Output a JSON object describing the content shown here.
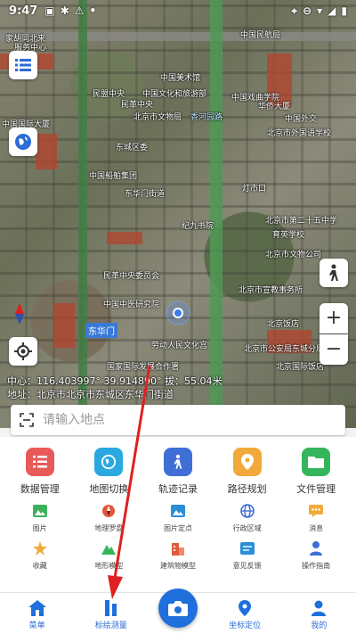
{
  "status_bar": {
    "time": "9:47"
  },
  "map": {
    "labels": [
      "家胡同北来",
      "服务中心",
      "中国民航局",
      "中国美术馆",
      "民盟中央",
      "中国文化和旅游部",
      "北京市文物局",
      "华侨大厦",
      "中国戏曲学院",
      "民革中央",
      "中国国际大厦",
      "中国外交",
      "香河园路",
      "北京市外国语学校",
      "东城区委",
      "中国船舶集团",
      "东华门街道",
      "灯市口",
      "纪九书院",
      "北京市第二十五中学",
      "育英学校",
      "北京市文物公司",
      "民革中央委员会",
      "北京市宣教事务所",
      "中国中医研究院",
      "东华门",
      "北京饭店",
      "北京市公安局东城分局",
      "北京国际饭店",
      "国家国际发展合作署",
      "劳动人民文化宫"
    ],
    "coord_line1": "中心：116.403997° 39.914890°  拔：55.04米",
    "coord_line2": "地址：北京市北京市东城区东华门街道"
  },
  "search": {
    "placeholder": "请输入地点"
  },
  "main_tools": [
    {
      "label": "数据管理",
      "icon": "list-icon",
      "color": "#e85a5a"
    },
    {
      "label": "地图切换",
      "icon": "globe-icon",
      "color": "#2aa8e0"
    },
    {
      "label": "轨迹记录",
      "icon": "walk-icon",
      "color": "#3f6fd6"
    },
    {
      "label": "路径规划",
      "icon": "location-pin-icon",
      "color": "#f2a93b"
    },
    {
      "label": "文件管理",
      "icon": "folder-icon",
      "color": "#35b55b"
    }
  ],
  "sub_tools_row1": [
    {
      "label": "图片",
      "icon": "image-icon",
      "color": "#3bb15b"
    },
    {
      "label": "地理罗盘",
      "icon": "compass-icon",
      "color": "#e05a3a"
    },
    {
      "label": "图片定点",
      "icon": "photo-pin-icon",
      "color": "#2a8fd6"
    },
    {
      "label": "行政区域",
      "icon": "globe-grid-icon",
      "color": "#3f6fd6"
    },
    {
      "label": "消息",
      "icon": "message-icon",
      "color": "#f2a93b"
    }
  ],
  "sub_tools_row2": [
    {
      "label": "收藏",
      "icon": "star-icon",
      "color": "#f2a93b"
    },
    {
      "label": "地形模型",
      "icon": "mountain-icon",
      "color": "#35b55b"
    },
    {
      "label": "建筑物模型",
      "icon": "building-icon",
      "color": "#e05a3a"
    },
    {
      "label": "意见反馈",
      "icon": "feedback-icon",
      "color": "#2a8fd6"
    },
    {
      "label": "操作指南",
      "icon": "user-guide-icon",
      "color": "#3f6fd6"
    }
  ],
  "bottom_nav": [
    {
      "label": "菜单",
      "icon": "home-icon"
    },
    {
      "label": "标绘测量",
      "icon": "measure-icon"
    },
    {
      "label": "坐标定位",
      "icon": "pin-icon"
    },
    {
      "label": "我的",
      "icon": "person-icon"
    }
  ],
  "colors": {
    "accent": "#1f6fdc",
    "nav_text": "#2d6bd6",
    "annotation": "#e02020"
  }
}
